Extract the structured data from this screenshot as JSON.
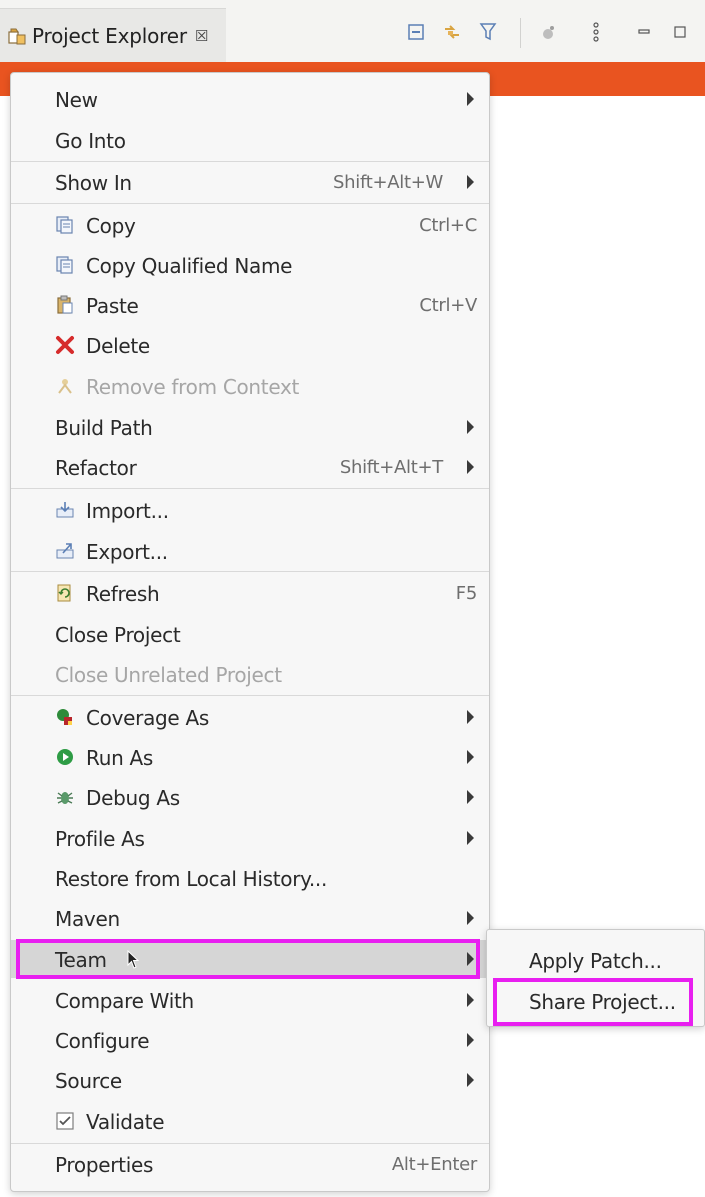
{
  "view": {
    "title": "Project Explorer",
    "close_glyph": "☒",
    "toolbar": [
      "collapse-all-icon",
      "link-with-editor-icon",
      "filter-icon",
      "focus-icon",
      "view-menu-icon",
      "minimize-icon",
      "maximize-icon"
    ]
  },
  "menu": {
    "new": "New",
    "go_into": "Go Into",
    "show_in": "Show In",
    "show_in_shortcut": "Shift+Alt+W",
    "copy": "Copy",
    "copy_shortcut": "Ctrl+C",
    "copy_qualified": "Copy Qualified Name",
    "paste": "Paste",
    "paste_shortcut": "Ctrl+V",
    "delete": "Delete",
    "remove_context": "Remove from Context",
    "build_path": "Build Path",
    "refactor": "Refactor",
    "refactor_shortcut": "Shift+Alt+T",
    "import": "Import...",
    "export": "Export...",
    "refresh": "Refresh",
    "refresh_shortcut": "F5",
    "close_project": "Close Project",
    "close_unrelated": "Close Unrelated Project",
    "coverage_as": "Coverage As",
    "run_as": "Run As",
    "debug_as": "Debug As",
    "profile_as": "Profile As",
    "restore_history": "Restore from Local History...",
    "maven": "Maven",
    "team": "Team",
    "compare_with": "Compare With",
    "configure": "Configure",
    "source": "Source",
    "validate": "Validate",
    "properties": "Properties",
    "properties_shortcut": "Alt+Enter"
  },
  "submenu": {
    "apply_patch": "Apply Patch...",
    "share_project": "Share Project..."
  },
  "colors": {
    "accent": "#e95420",
    "annotation": "#e81ff0",
    "highlight": "#d6d6d6"
  }
}
